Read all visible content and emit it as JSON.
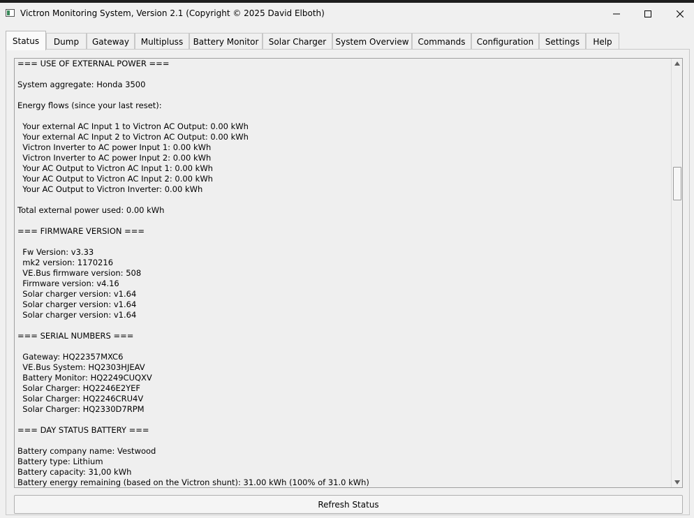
{
  "window": {
    "title": "Victron Monitoring System, Version 2.1 (Copyright © 2025 David Elboth)"
  },
  "tabs": [
    {
      "label": "Status",
      "active": true
    },
    {
      "label": "Dump"
    },
    {
      "label": "Gateway"
    },
    {
      "label": "Multipluss"
    },
    {
      "label": "Battery Monitor"
    },
    {
      "label": "Solar Charger"
    },
    {
      "label": "System Overview"
    },
    {
      "label": "Commands"
    },
    {
      "label": "Configuration"
    },
    {
      "label": "Settings"
    },
    {
      "label": "Help"
    }
  ],
  "status_text": [
    "=== USE OF EXTERNAL POWER ===",
    "",
    "System aggregate: Honda 3500",
    "",
    "Energy flows (since your last reset):",
    "",
    "  Your external AC Input 1 to Victron AC Output: 0.00 kWh",
    "  Your external AC Input 2 to Victron AC Output: 0.00 kWh",
    "  Victron Inverter to AC power Input 1: 0.00 kWh",
    "  Victron Inverter to AC power Input 2: 0.00 kWh",
    "  Your AC Output to Victron AC Input 1: 0.00 kWh",
    "  Your AC Output to Victron AC Input 2: 0.00 kWh",
    "  Your AC Output to Victron Inverter: 0.00 kWh",
    "",
    "Total external power used: 0.00 kWh",
    "",
    "=== FIRMWARE VERSION ===",
    "",
    "  Fw Version: v3.33",
    "  mk2 version: 1170216",
    "  VE.Bus firmware version: 508",
    "  Firmware version: v4.16",
    "  Solar charger version: v1.64",
    "  Solar charger version: v1.64",
    "  Solar charger version: v1.64",
    "",
    "=== SERIAL NUMBERS ===",
    "",
    "  Gateway: HQ22357MXC6",
    "  VE.Bus System: HQ2303HJEAV",
    "  Battery Monitor: HQ2249CUQXV",
    "  Solar Charger: HQ2246E2YEF",
    "  Solar Charger: HQ2246CRU4V",
    "  Solar Charger: HQ2330D7RPM",
    "",
    "=== DAY STATUS BATTERY ===",
    "",
    "Battery company name: Vestwood",
    "Battery type: Lithium",
    "Battery capacity: 31,00 kWh",
    "Battery energy remaining (based on the Victron shunt): 31.00 kWh (100% of 31.0 kWh)"
  ],
  "buttons": {
    "refresh": "Refresh Status"
  }
}
